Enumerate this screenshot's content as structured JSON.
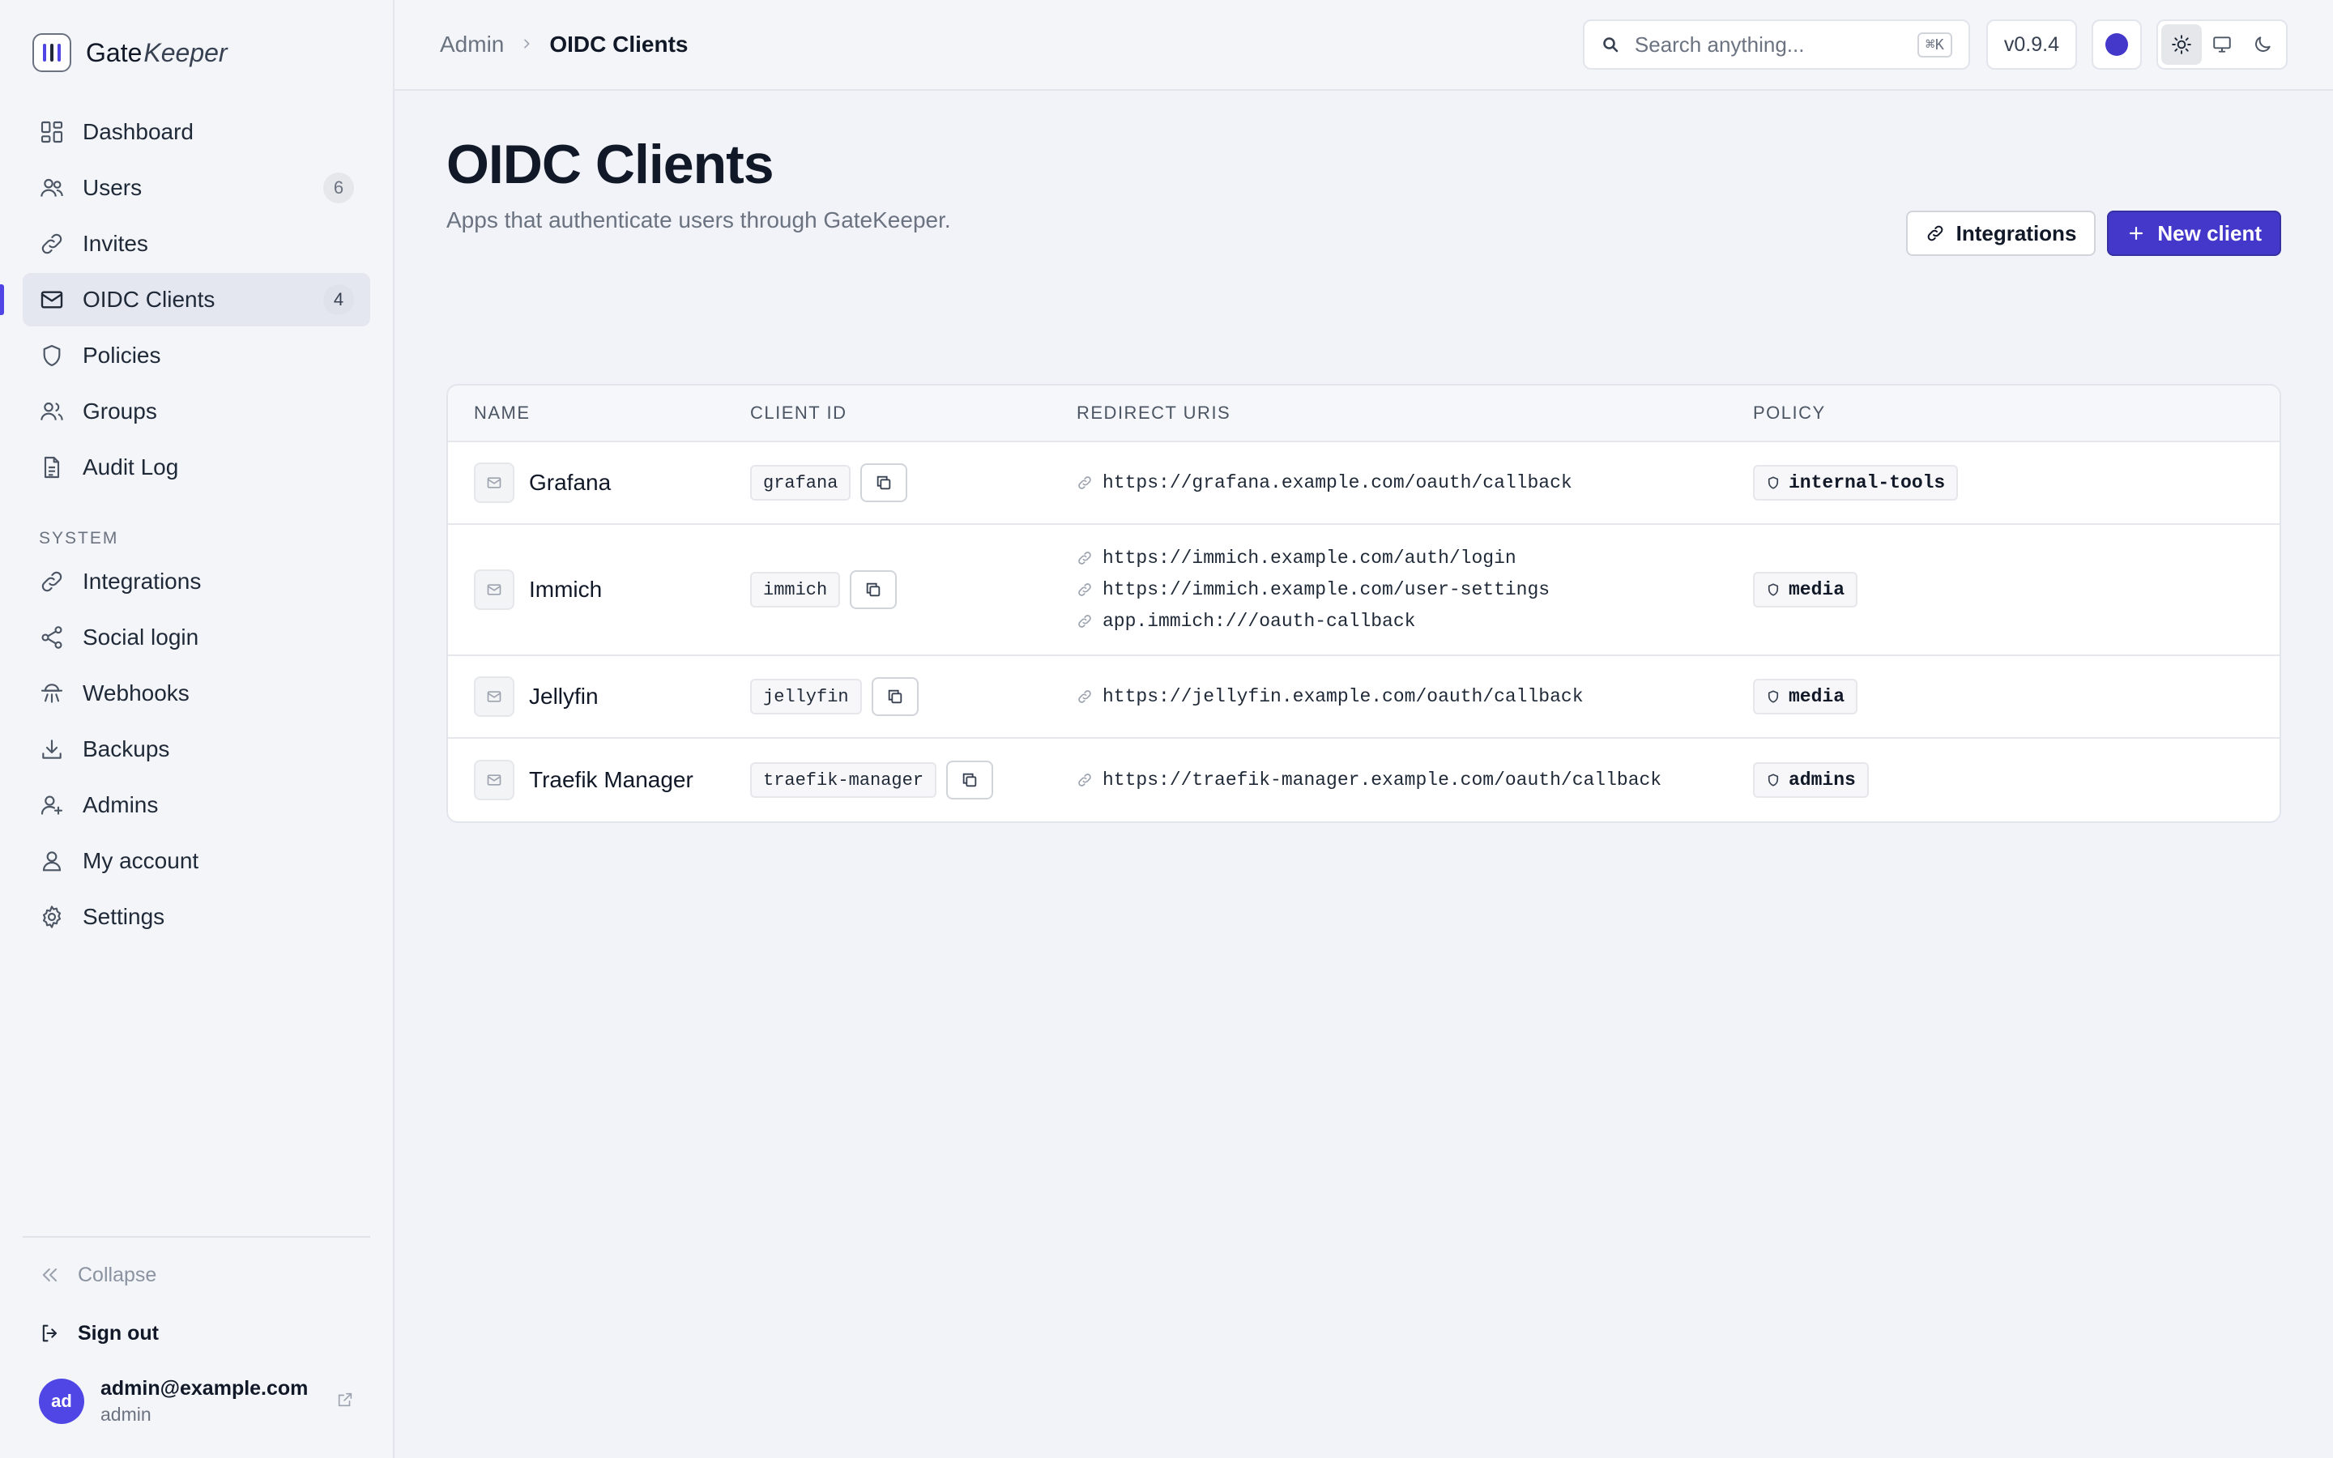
{
  "brand": {
    "name_part1": "Gate",
    "name_part2": "Keeper"
  },
  "sidebar": {
    "items": [
      {
        "label": "Dashboard",
        "icon": "dashboard-icon",
        "badge": ""
      },
      {
        "label": "Users",
        "icon": "users-icon",
        "badge": "6"
      },
      {
        "label": "Invites",
        "icon": "link-icon",
        "badge": ""
      },
      {
        "label": "OIDC Clients",
        "icon": "mail-icon",
        "badge": "4",
        "active": true
      },
      {
        "label": "Policies",
        "icon": "shield-icon",
        "badge": ""
      },
      {
        "label": "Groups",
        "icon": "group-icon",
        "badge": ""
      },
      {
        "label": "Audit Log",
        "icon": "document-icon",
        "badge": ""
      }
    ],
    "system_label": "SYSTEM",
    "system_items": [
      {
        "label": "Integrations",
        "icon": "link-icon"
      },
      {
        "label": "Social login",
        "icon": "share-icon"
      },
      {
        "label": "Webhooks",
        "icon": "webhook-icon"
      },
      {
        "label": "Backups",
        "icon": "download-icon"
      },
      {
        "label": "Admins",
        "icon": "user-plus-icon"
      },
      {
        "label": "My account",
        "icon": "user-icon"
      },
      {
        "label": "Settings",
        "icon": "gear-icon"
      }
    ],
    "collapse_label": "Collapse",
    "signout_label": "Sign out",
    "user": {
      "initials": "ad",
      "email": "admin@example.com",
      "role": "admin"
    }
  },
  "topbar": {
    "breadcrumb": [
      "Admin",
      "OIDC Clients"
    ],
    "search_placeholder": "Search anything...",
    "search_shortcut": "⌘K",
    "version": "v0.9.4",
    "accent_color": "#4338ca",
    "theme_active": "light"
  },
  "page": {
    "title": "OIDC Clients",
    "subtitle": "Apps that authenticate users through GateKeeper.",
    "integrations_label": "Integrations",
    "new_client_label": "New client"
  },
  "table": {
    "columns": [
      "NAME",
      "CLIENT ID",
      "REDIRECT URIS",
      "POLICY"
    ],
    "rows": [
      {
        "name": "Grafana",
        "client_id": "grafana",
        "uris": [
          "https://grafana.example.com/oauth/callback"
        ],
        "policy": "internal-tools"
      },
      {
        "name": "Immich",
        "client_id": "immich",
        "uris": [
          "https://immich.example.com/auth/login",
          "https://immich.example.com/user-settings",
          "app.immich:///oauth-callback"
        ],
        "policy": "media"
      },
      {
        "name": "Jellyfin",
        "client_id": "jellyfin",
        "uris": [
          "https://jellyfin.example.com/oauth/callback"
        ],
        "policy": "media"
      },
      {
        "name": "Traefik Manager",
        "client_id": "traefik-manager",
        "uris": [
          "https://traefik-manager.example.com/oauth/callback"
        ],
        "policy": "admins"
      }
    ]
  },
  "colors": {
    "accent": "#4338ca",
    "background": "#f1f3f8",
    "sidebar": "#f3f5f9"
  }
}
